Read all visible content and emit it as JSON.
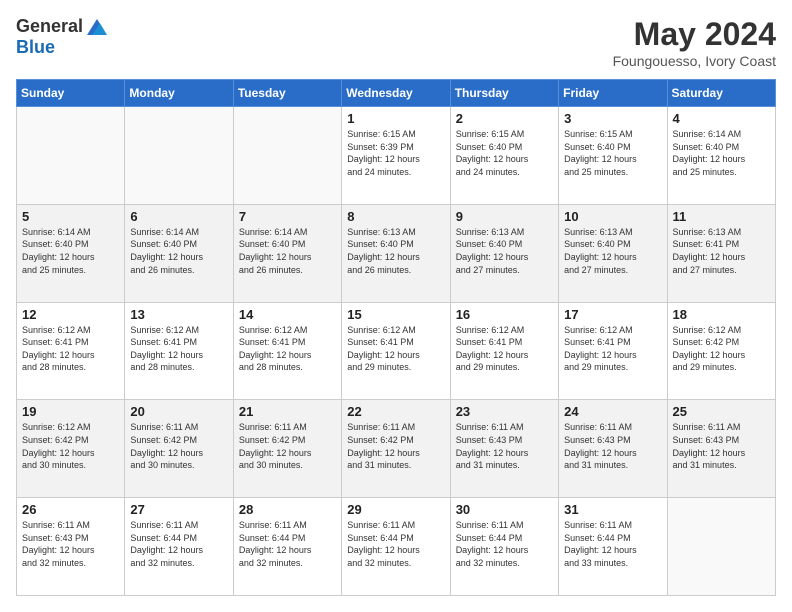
{
  "header": {
    "logo_general": "General",
    "logo_blue": "Blue",
    "month_title": "May 2024",
    "location": "Foungouesso, Ivory Coast"
  },
  "days_of_week": [
    "Sunday",
    "Monday",
    "Tuesday",
    "Wednesday",
    "Thursday",
    "Friday",
    "Saturday"
  ],
  "weeks": [
    [
      {
        "day": "",
        "info": ""
      },
      {
        "day": "",
        "info": ""
      },
      {
        "day": "",
        "info": ""
      },
      {
        "day": "1",
        "info": "Sunrise: 6:15 AM\nSunset: 6:39 PM\nDaylight: 12 hours\nand 24 minutes."
      },
      {
        "day": "2",
        "info": "Sunrise: 6:15 AM\nSunset: 6:40 PM\nDaylight: 12 hours\nand 24 minutes."
      },
      {
        "day": "3",
        "info": "Sunrise: 6:15 AM\nSunset: 6:40 PM\nDaylight: 12 hours\nand 25 minutes."
      },
      {
        "day": "4",
        "info": "Sunrise: 6:14 AM\nSunset: 6:40 PM\nDaylight: 12 hours\nand 25 minutes."
      }
    ],
    [
      {
        "day": "5",
        "info": "Sunrise: 6:14 AM\nSunset: 6:40 PM\nDaylight: 12 hours\nand 25 minutes."
      },
      {
        "day": "6",
        "info": "Sunrise: 6:14 AM\nSunset: 6:40 PM\nDaylight: 12 hours\nand 26 minutes."
      },
      {
        "day": "7",
        "info": "Sunrise: 6:14 AM\nSunset: 6:40 PM\nDaylight: 12 hours\nand 26 minutes."
      },
      {
        "day": "8",
        "info": "Sunrise: 6:13 AM\nSunset: 6:40 PM\nDaylight: 12 hours\nand 26 minutes."
      },
      {
        "day": "9",
        "info": "Sunrise: 6:13 AM\nSunset: 6:40 PM\nDaylight: 12 hours\nand 27 minutes."
      },
      {
        "day": "10",
        "info": "Sunrise: 6:13 AM\nSunset: 6:40 PM\nDaylight: 12 hours\nand 27 minutes."
      },
      {
        "day": "11",
        "info": "Sunrise: 6:13 AM\nSunset: 6:41 PM\nDaylight: 12 hours\nand 27 minutes."
      }
    ],
    [
      {
        "day": "12",
        "info": "Sunrise: 6:12 AM\nSunset: 6:41 PM\nDaylight: 12 hours\nand 28 minutes."
      },
      {
        "day": "13",
        "info": "Sunrise: 6:12 AM\nSunset: 6:41 PM\nDaylight: 12 hours\nand 28 minutes."
      },
      {
        "day": "14",
        "info": "Sunrise: 6:12 AM\nSunset: 6:41 PM\nDaylight: 12 hours\nand 28 minutes."
      },
      {
        "day": "15",
        "info": "Sunrise: 6:12 AM\nSunset: 6:41 PM\nDaylight: 12 hours\nand 29 minutes."
      },
      {
        "day": "16",
        "info": "Sunrise: 6:12 AM\nSunset: 6:41 PM\nDaylight: 12 hours\nand 29 minutes."
      },
      {
        "day": "17",
        "info": "Sunrise: 6:12 AM\nSunset: 6:41 PM\nDaylight: 12 hours\nand 29 minutes."
      },
      {
        "day": "18",
        "info": "Sunrise: 6:12 AM\nSunset: 6:42 PM\nDaylight: 12 hours\nand 29 minutes."
      }
    ],
    [
      {
        "day": "19",
        "info": "Sunrise: 6:12 AM\nSunset: 6:42 PM\nDaylight: 12 hours\nand 30 minutes."
      },
      {
        "day": "20",
        "info": "Sunrise: 6:11 AM\nSunset: 6:42 PM\nDaylight: 12 hours\nand 30 minutes."
      },
      {
        "day": "21",
        "info": "Sunrise: 6:11 AM\nSunset: 6:42 PM\nDaylight: 12 hours\nand 30 minutes."
      },
      {
        "day": "22",
        "info": "Sunrise: 6:11 AM\nSunset: 6:42 PM\nDaylight: 12 hours\nand 31 minutes."
      },
      {
        "day": "23",
        "info": "Sunrise: 6:11 AM\nSunset: 6:43 PM\nDaylight: 12 hours\nand 31 minutes."
      },
      {
        "day": "24",
        "info": "Sunrise: 6:11 AM\nSunset: 6:43 PM\nDaylight: 12 hours\nand 31 minutes."
      },
      {
        "day": "25",
        "info": "Sunrise: 6:11 AM\nSunset: 6:43 PM\nDaylight: 12 hours\nand 31 minutes."
      }
    ],
    [
      {
        "day": "26",
        "info": "Sunrise: 6:11 AM\nSunset: 6:43 PM\nDaylight: 12 hours\nand 32 minutes."
      },
      {
        "day": "27",
        "info": "Sunrise: 6:11 AM\nSunset: 6:44 PM\nDaylight: 12 hours\nand 32 minutes."
      },
      {
        "day": "28",
        "info": "Sunrise: 6:11 AM\nSunset: 6:44 PM\nDaylight: 12 hours\nand 32 minutes."
      },
      {
        "day": "29",
        "info": "Sunrise: 6:11 AM\nSunset: 6:44 PM\nDaylight: 12 hours\nand 32 minutes."
      },
      {
        "day": "30",
        "info": "Sunrise: 6:11 AM\nSunset: 6:44 PM\nDaylight: 12 hours\nand 32 minutes."
      },
      {
        "day": "31",
        "info": "Sunrise: 6:11 AM\nSunset: 6:44 PM\nDaylight: 12 hours\nand 33 minutes."
      },
      {
        "day": "",
        "info": ""
      }
    ]
  ]
}
